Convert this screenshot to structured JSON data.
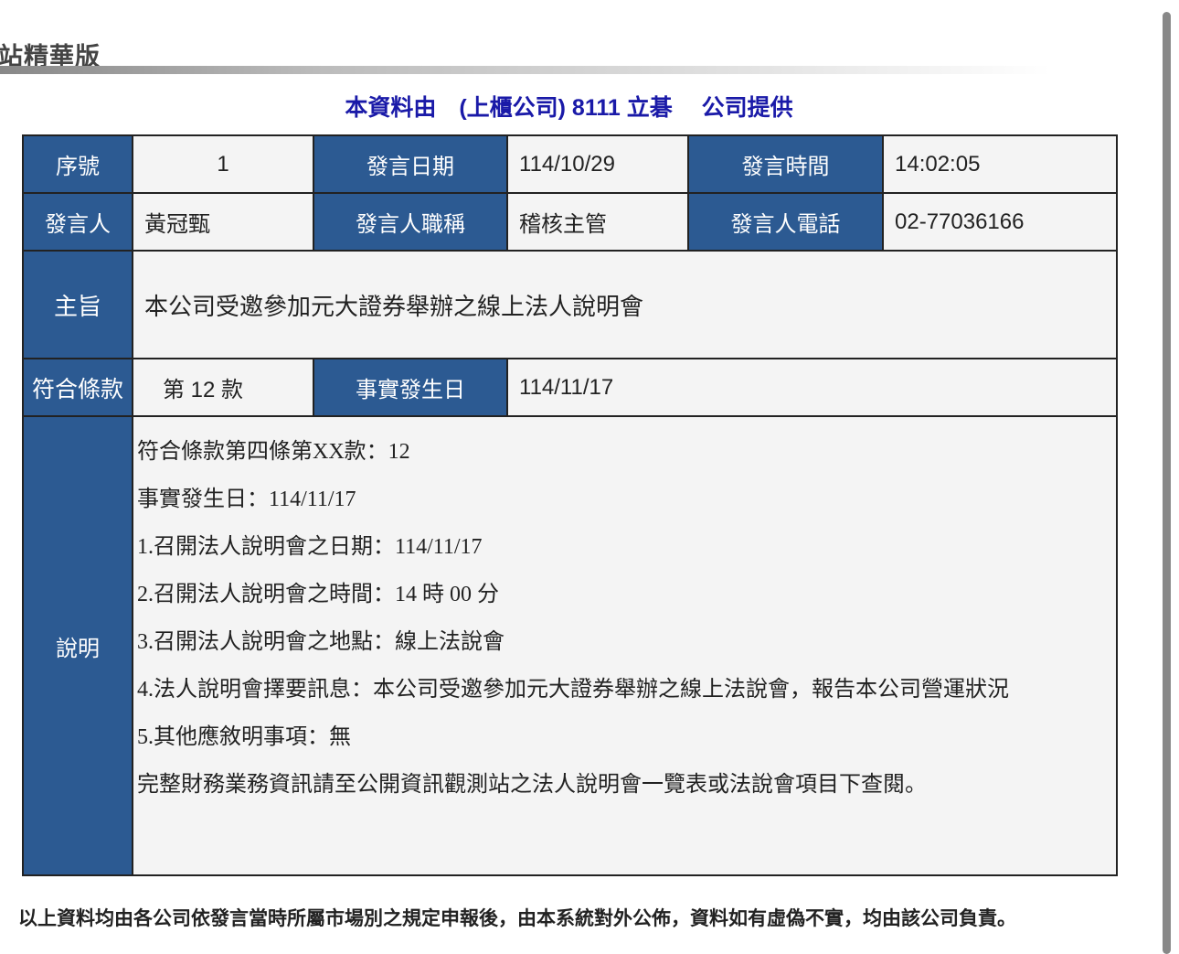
{
  "site_title": "站精華版",
  "provider": "本資料由　(上櫃公司) 8111 立碁　 公司提供",
  "rows": {
    "seq_label": "序號",
    "seq": "1",
    "date_label": "發言日期",
    "date": "114/10/29",
    "time_label": "發言時間",
    "time": "14:02:05",
    "speaker_label": "發言人",
    "speaker": "黃冠甄",
    "title_label": "發言人職稱",
    "title": "稽核主管",
    "phone_label": "發言人電話",
    "phone": "02-77036166",
    "subject_label": "主旨",
    "subject": "本公司受邀參加元大證券舉辦之線上法人說明會",
    "clause_label": "符合條款",
    "clause": "第 12 款",
    "fact_date_label": "事實發生日",
    "fact_date": "114/11/17",
    "desc_label": "說明",
    "desc_lines": [
      "符合條款第四條第XX款：12",
      "事實發生日：114/11/17",
      "1.召開法人說明會之日期：114/11/17",
      "2.召開法人說明會之時間：14 時 00 分",
      "3.召開法人說明會之地點：線上法說會",
      "4.法人說明會擇要訊息：本公司受邀參加元大證券舉辦之線上法說會，報告本公司營運狀況",
      "5.其他應敘明事項：無",
      "完整財務業務資訊請至公開資訊觀測站之法人說明會一覽表或法說會項目下查閱。"
    ]
  },
  "footer": "以上資料均由各公司依發言當時所屬市場別之規定申報後，由本系統對外公佈，資料如有虛偽不實，均由該公司負責。",
  "colors": {
    "header_bg": "#2c5a92",
    "provider_text": "#1a1aa8"
  }
}
